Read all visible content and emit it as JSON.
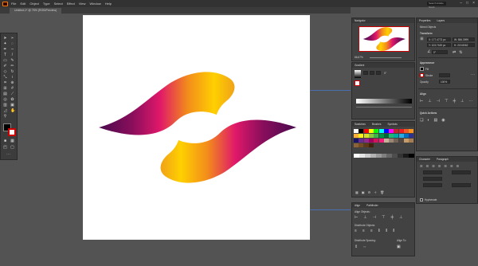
{
  "app": {
    "menu": [
      "File",
      "Edit",
      "Object",
      "Type",
      "Select",
      "Effect",
      "View",
      "Window",
      "Help"
    ],
    "search_placeholder": "Search Adobe Stock",
    "doc_tab": "Untitled-1* @ 75% (RGB/Preview)"
  },
  "panels": {
    "navigator": {
      "title": "Navigator",
      "zoom": "66.67%"
    },
    "gradient": {
      "title": "Gradient",
      "type_label": "Type:",
      "angle": "0°",
      "opacity_label": "Opacity:",
      "location_label": "Location:"
    },
    "swatches": {
      "tabs": [
        "Swatches",
        "Brushes",
        "Symbols"
      ]
    },
    "align": {
      "tabs": [
        "Align",
        "Pathfinder"
      ],
      "align_objects": "Align Objects:",
      "distribute_objects": "Distribute Objects:",
      "distribute_spacing": "Distribute Spacing:",
      "align_to": "Align To:"
    },
    "properties": {
      "tabs": [
        "Properties",
        "Layers"
      ],
      "selection": "Mixed Objects",
      "transform_title": "Transform",
      "x": "X: 177.4773 px",
      "y": "Y: 103.7169 px",
      "w": "W: 556.3999",
      "h": "H: 219.8062",
      "angle": "0°",
      "appearance_title": "Appearance",
      "fill_label": "Fill",
      "stroke_label": "Stroke",
      "opacity_label": "Opacity",
      "opacity_value": "100%",
      "align_title": "Align",
      "quick_actions_title": "Quick Actions"
    },
    "char_para": {
      "tabs": [
        "Character",
        "Paragraph"
      ],
      "hyphenate": "Hyphenate"
    }
  },
  "colors": {
    "ui_bg": "#535353",
    "panel": "#424242",
    "panel_title": "#383838",
    "menubar": "#323232",
    "ribbon_purple": "#5c0a5a",
    "ribbon_magenta": "#e0186a",
    "ribbon_orange": "#f08a1a",
    "ribbon_yellow": "#ffcc00"
  },
  "swatch_colors": [
    "#ffffff",
    "#000000",
    "#ff0000",
    "#ffff00",
    "#00ff00",
    "#00ffff",
    "#0000ff",
    "#ff00ff",
    "#c1272d",
    "#ed1c24",
    "#f15a24",
    "#f7931e",
    "#fbb03b",
    "#fcee21",
    "#d9e021",
    "#8cc63f",
    "#39b54a",
    "#009245",
    "#006837",
    "#22b573",
    "#00a99d",
    "#29abe2",
    "#0071bc",
    "#2e3192",
    "#1b1464",
    "#662d91",
    "#93278f",
    "#9e005d",
    "#d4145a",
    "#ed1e79",
    "#c7b299",
    "#998675",
    "#736357",
    "#534741",
    "#c69c6d",
    "#a67c52",
    "#8c6239",
    "#754c24",
    "#603813",
    "#42210b"
  ]
}
